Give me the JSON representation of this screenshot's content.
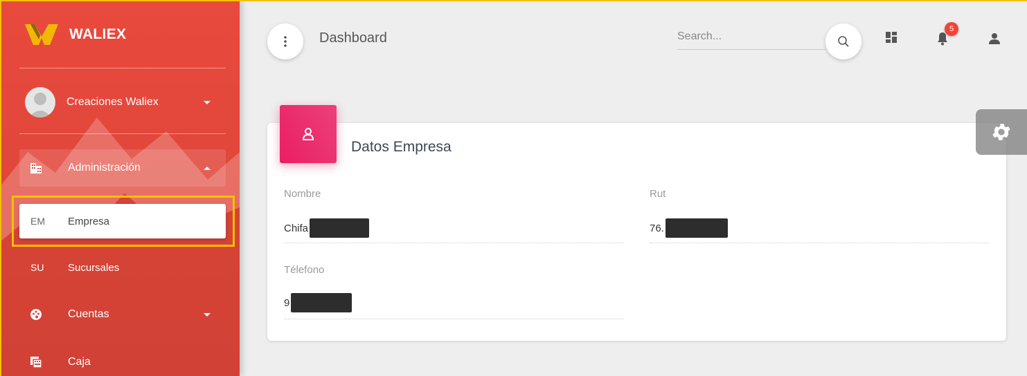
{
  "sidebar": {
    "brand": "WALIEX",
    "user": {
      "name": "Creaciones Waliex"
    },
    "items": [
      {
        "label": "Administración",
        "icon": "building-icon",
        "expanded": true
      },
      {
        "abbr": "EM",
        "label": "Empresa",
        "selected": true
      },
      {
        "abbr": "SU",
        "label": "Sucursales"
      },
      {
        "label": "Cuentas",
        "icon": "palette-icon"
      },
      {
        "label": "Caja",
        "icon": "cash-register-icon"
      }
    ]
  },
  "topbar": {
    "title": "Dashboard",
    "search_placeholder": "Search...",
    "notification_count": "5"
  },
  "card": {
    "title": "Datos Empresa",
    "fields": [
      {
        "label": "Nombre",
        "value": "Chifa"
      },
      {
        "label": "Rut",
        "value": "76."
      },
      {
        "label": "Télefono",
        "value": "9"
      }
    ]
  },
  "colors": {
    "sidebar": "#e2473b",
    "card_icon": "#e91e63",
    "badge": "#f44336",
    "highlight": "#f2c200"
  }
}
